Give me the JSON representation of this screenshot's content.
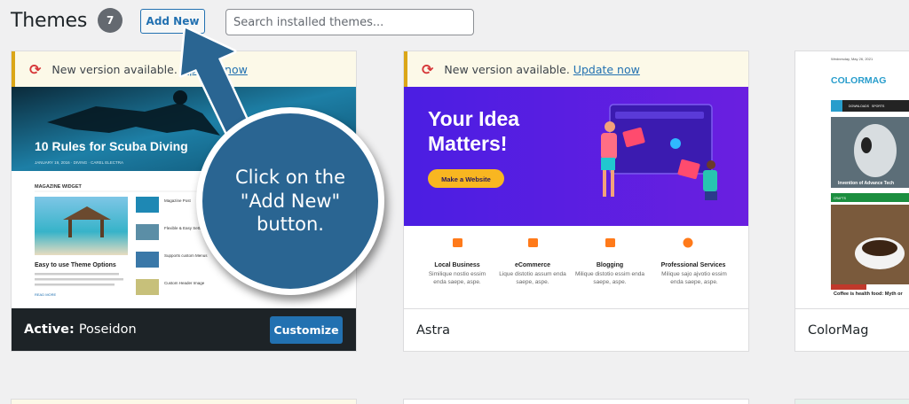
{
  "header": {
    "title": "Themes",
    "count": "7",
    "add_new_label": "Add New",
    "search_placeholder": "Search installed themes..."
  },
  "themes": [
    {
      "name": "Poseidon",
      "active_label": "Active:",
      "action_label": "Customize",
      "notice": {
        "text": "New version available.",
        "link": "Update now"
      },
      "preview": {
        "hero_title": "10 Rules for Scuba Diving",
        "hero_meta": "JANUARY 19, 2016  ·  DIVING  ·  CAREL ELECTRA",
        "widget_title": "MAGAZINE WIDGET",
        "post_title": "Easy to use Theme Options",
        "read_more": "READ MORE",
        "side_posts": [
          "Magazine Post",
          "Flexible & Easy Settings",
          "Custom Header Menus",
          "Supports custom Menus",
          "Custom Header Image"
        ]
      }
    },
    {
      "name": "Astra",
      "notice": {
        "text": "New version available.",
        "link": "Update now"
      },
      "preview": {
        "hero_line1": "Your Idea",
        "hero_line2": "Matters!",
        "cta": "Make a Website",
        "features": [
          {
            "title": "Local Business",
            "desc": "Similique nostio essim enda saepe, aspe."
          },
          {
            "title": "eCommerce",
            "desc": "Lique distotio assum enda saepe, aspe."
          },
          {
            "title": "Blogging",
            "desc": "Milique distotio essim enda saepe, aspe."
          },
          {
            "title": "Professional Services",
            "desc": "Milique sajo ajvotio essim enda saepe, aspe."
          }
        ]
      }
    },
    {
      "name": "ColorMag",
      "preview": {
        "date": "Wednesday, May 26, 2021",
        "logo": "COLORMAG",
        "nav": [
          "DOWNLOADS",
          "SPORTS",
          "POL"
        ],
        "category": "CRAFTS",
        "post1": "Invention of Advance Tech",
        "post2": "Coffee is health food: Myth or"
      }
    }
  ],
  "callout": {
    "text": "Click on the \"Add New\" button."
  },
  "colors": {
    "wp_blue": "#2271b1",
    "notice_bg": "#fcf9e8",
    "callout_blue": "#2a6592",
    "astra_purple": "#4c1fe6"
  }
}
